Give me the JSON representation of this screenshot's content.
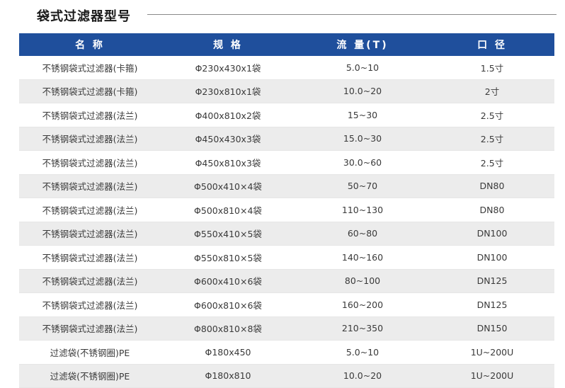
{
  "page": {
    "title": "袋式过滤器型号"
  },
  "colors": {
    "header_bg": "#1f4f9c",
    "header_text": "#ffffff",
    "row_alt_bg": "#ececec"
  },
  "table": {
    "headers": [
      "名 称",
      "规 格",
      "流 量(T)",
      "口 径"
    ],
    "rows": [
      [
        "不锈钢袋式过滤器(卡箍)",
        "Φ230x430x1袋",
        "5.0~10",
        "1.5寸"
      ],
      [
        "不锈钢袋式过滤器(卡箍)",
        "Φ230x810x1袋",
        "10.0~20",
        "2寸"
      ],
      [
        "不锈钢袋式过滤器(法兰)",
        "Φ400x810x2袋",
        "15~30",
        "2.5寸"
      ],
      [
        "不锈钢袋式过滤器(法兰)",
        "Φ450x430x3袋",
        "15.0~30",
        "2.5寸"
      ],
      [
        "不锈钢袋式过滤器(法兰)",
        "Φ450x810x3袋",
        "30.0~60",
        "2.5寸"
      ],
      [
        "不锈钢袋式过滤器(法兰)",
        "Φ500x410×4袋",
        "50~70",
        "DN80"
      ],
      [
        "不锈钢袋式过滤器(法兰)",
        "Φ500x810×4袋",
        "110~130",
        "DN80"
      ],
      [
        "不锈钢袋式过滤器(法兰)",
        "Φ550x410×5袋",
        "60~80",
        "DN100"
      ],
      [
        "不锈钢袋式过滤器(法兰)",
        "Φ550x810×5袋",
        "140~160",
        "DN100"
      ],
      [
        "不锈钢袋式过滤器(法兰)",
        "Φ600x410×6袋",
        "80~100",
        "DN125"
      ],
      [
        "不锈钢袋式过滤器(法兰)",
        "Φ600x810×6袋",
        "160~200",
        "DN125"
      ],
      [
        "不锈钢袋式过滤器(法兰)",
        "Φ800x810×8袋",
        "210~350",
        "DN150"
      ],
      [
        "过滤袋(不锈钢圈)PE",
        "Φ180x450",
        "5.0~10",
        "1U~200U"
      ],
      [
        "过滤袋(不锈钢圈)PE",
        "Φ180x810",
        "10.0~20",
        "1U~200U"
      ]
    ]
  }
}
